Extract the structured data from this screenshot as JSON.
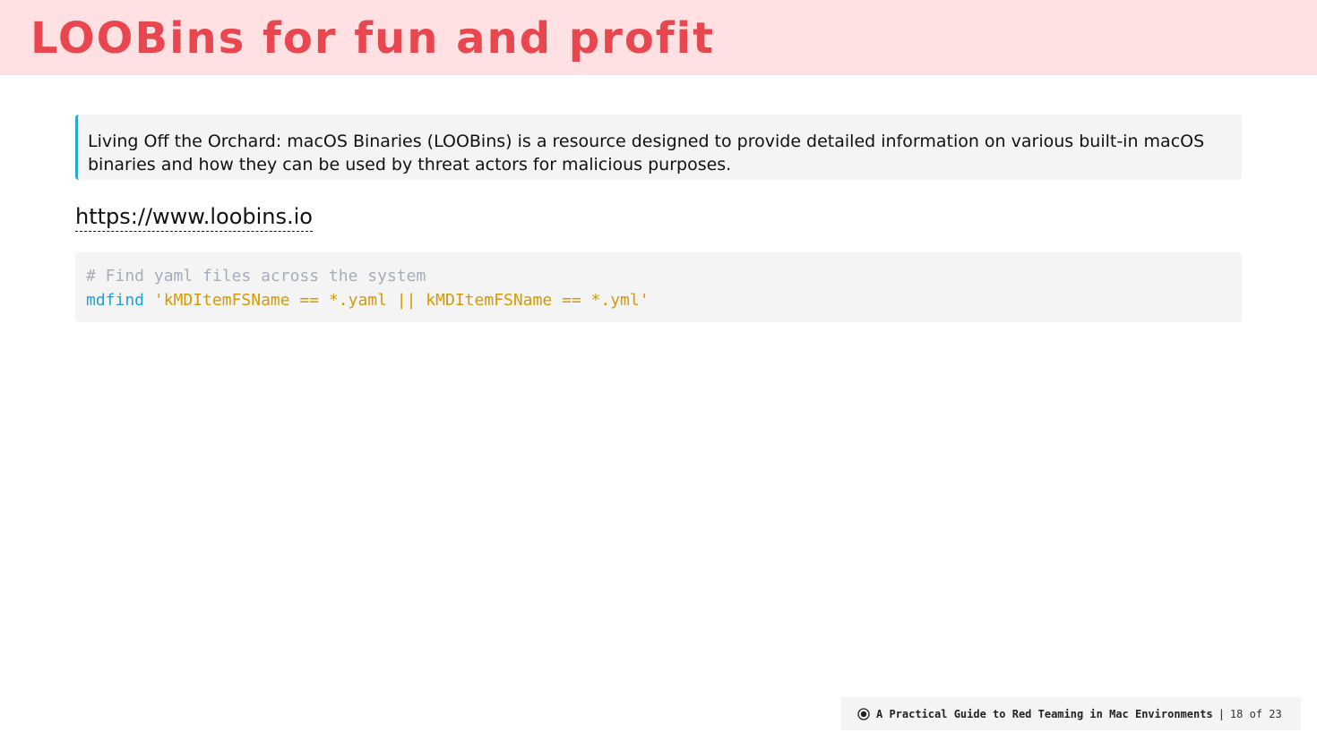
{
  "slide": {
    "title": "LOOBins for fun and profit",
    "quote": "Living Off the Orchard: macOS Binaries (LOOBins) is a resource designed to provide detailed information on various built-in macOS binaries and how they can be used by threat actors for malicious purposes.",
    "link": "https://www.loobins.io",
    "code": {
      "comment": "# Find yaml files across the system",
      "command": "mdfind",
      "argument": "'kMDItemFSName == *.yaml || kMDItemFSName == *.yml'"
    }
  },
  "footer": {
    "logo_icon": "target-icon",
    "presentation_title": "A Practical Guide to Red Teaming in Mac Environments",
    "separator": "|",
    "page_indicator": "18 of 23"
  },
  "colors": {
    "header_bg": "#ffe0e3",
    "title": "#e8474f",
    "quote_border": "#29a9c8",
    "panel_bg": "#f4f4f4",
    "code_comment": "#a6adba",
    "code_command": "#1aa3d6",
    "code_string": "#d49a00"
  }
}
